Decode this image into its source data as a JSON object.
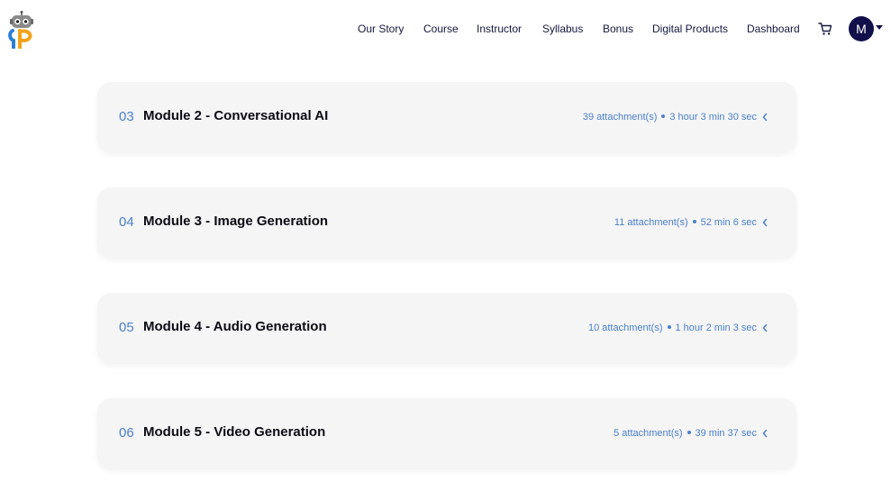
{
  "nav": {
    "items": [
      {
        "label": "Our Story"
      },
      {
        "label": "Course"
      },
      {
        "label": "Instructor"
      },
      {
        "label": "Syllabus"
      },
      {
        "label": "Bonus"
      },
      {
        "label": "Digital Products"
      },
      {
        "label": "Dashboard"
      }
    ],
    "cart_icon": "cart-icon",
    "avatar_initial": "M"
  },
  "modules": [
    {
      "number": "03",
      "title": "Module 2 - Conversational AI",
      "attachments": "39 attachment(s)",
      "duration": "3 hour 3 min 30 sec"
    },
    {
      "number": "04",
      "title": "Module 3 - Image Generation",
      "attachments": "11 attachment(s)",
      "duration": "52 min 6 sec"
    },
    {
      "number": "05",
      "title": "Module 4 - Audio Generation",
      "attachments": "10 attachment(s)",
      "duration": "1 hour 2 min 3 sec"
    },
    {
      "number": "06",
      "title": "Module 5 - Video Generation",
      "attachments": "5 attachment(s)",
      "duration": "39 min 37 sec"
    }
  ],
  "colors": {
    "accent": "#4a7fcc",
    "nav_text": "#15173f",
    "avatar_bg": "#11104a",
    "card_bg": "#f5f5f5"
  }
}
